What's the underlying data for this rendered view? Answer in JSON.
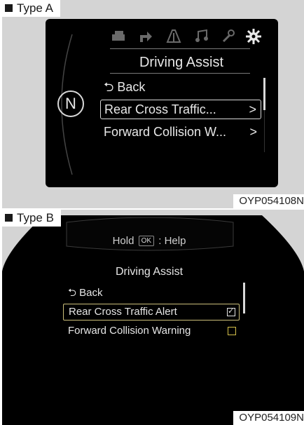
{
  "panel_a": {
    "type_label": "Type A",
    "code": "OYP054108N",
    "gear_indicator": "N",
    "tab_icons": [
      "car-info-icon",
      "navigation-arrow-icon",
      "road-lanes-icon",
      "music-note-icon",
      "wrench-icon",
      "settings-gear-icon"
    ],
    "active_tab": "settings-gear-icon",
    "title": "Driving Assist",
    "menu": [
      {
        "label": "⮌ Back",
        "suffix": ""
      },
      {
        "label": "Rear Cross Traffic...",
        "suffix": ">"
      },
      {
        "label": "Forward Collision W...",
        "suffix": ">"
      }
    ],
    "selected_index": 1
  },
  "panel_b": {
    "type_label": "Type B",
    "code": "OYP054109N",
    "hold_prefix": "Hold",
    "ok_key": "OK",
    "hold_suffix": ": Help",
    "title": "Driving Assist",
    "menu": [
      {
        "label": "⮌ Back"
      },
      {
        "label": "Rear Cross Traffic Alert",
        "checked": true
      },
      {
        "label": "Forward Collision Warning",
        "checked": false
      }
    ],
    "selected_index": 1
  },
  "colors": {
    "screen": "#000000",
    "surround": "#d4d4d4",
    "text": "#e6e6e6",
    "selection_b": "#cbbf7a"
  }
}
